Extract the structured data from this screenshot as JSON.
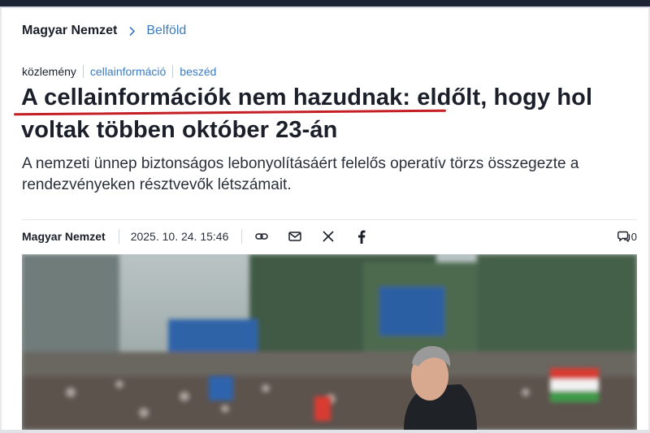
{
  "breadcrumb": {
    "home": "Magyar Nemzet",
    "category": "Belföld"
  },
  "tags": [
    "közlemény",
    "cellainformáció",
    "beszéd"
  ],
  "article": {
    "title": "A cellainformációk nem hazudnak: eldőlt, hogy hol voltak többen október 23-án",
    "lead": "A nemzeti ünnep biztonságos lebonyolításáért felelős operatív törzs összegezte a rendezvényeken résztvevők létszámait."
  },
  "meta": {
    "author": "Magyar Nemzet",
    "date": "2025. 10. 24. 15:46",
    "comment_count": "0"
  },
  "share_icons": [
    "link-icon",
    "mail-icon",
    "x-icon",
    "facebook-icon"
  ],
  "colors": {
    "accent": "#3b7bbf",
    "underline": "#c51f26",
    "topbar": "#1c2433",
    "flag_red": "#d93a33",
    "flag_green": "#3f9a4a"
  }
}
